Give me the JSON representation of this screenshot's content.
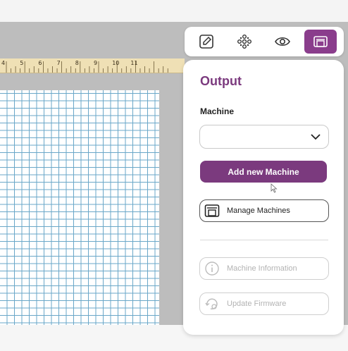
{
  "ruler": {
    "ticks": [
      "4",
      "5",
      "6",
      "7",
      "8",
      "9",
      "10",
      "11"
    ]
  },
  "toolbar": {
    "icons": [
      "edit-icon",
      "transform-icon",
      "preview-icon",
      "output-icon"
    ],
    "active": "output-icon"
  },
  "panel": {
    "title": "Output",
    "machine_label": "Machine",
    "machine_select_value": "",
    "add_button": "Add new Machine",
    "manage_button": "Manage Machines",
    "info_button": "Machine Information",
    "firmware_button": "Update Firmware"
  },
  "colors": {
    "accent": "#7b3a7e",
    "active_tab": "#8a3d8c",
    "grid_line": "#6aa7c8",
    "ruler": "#efe0b5"
  }
}
